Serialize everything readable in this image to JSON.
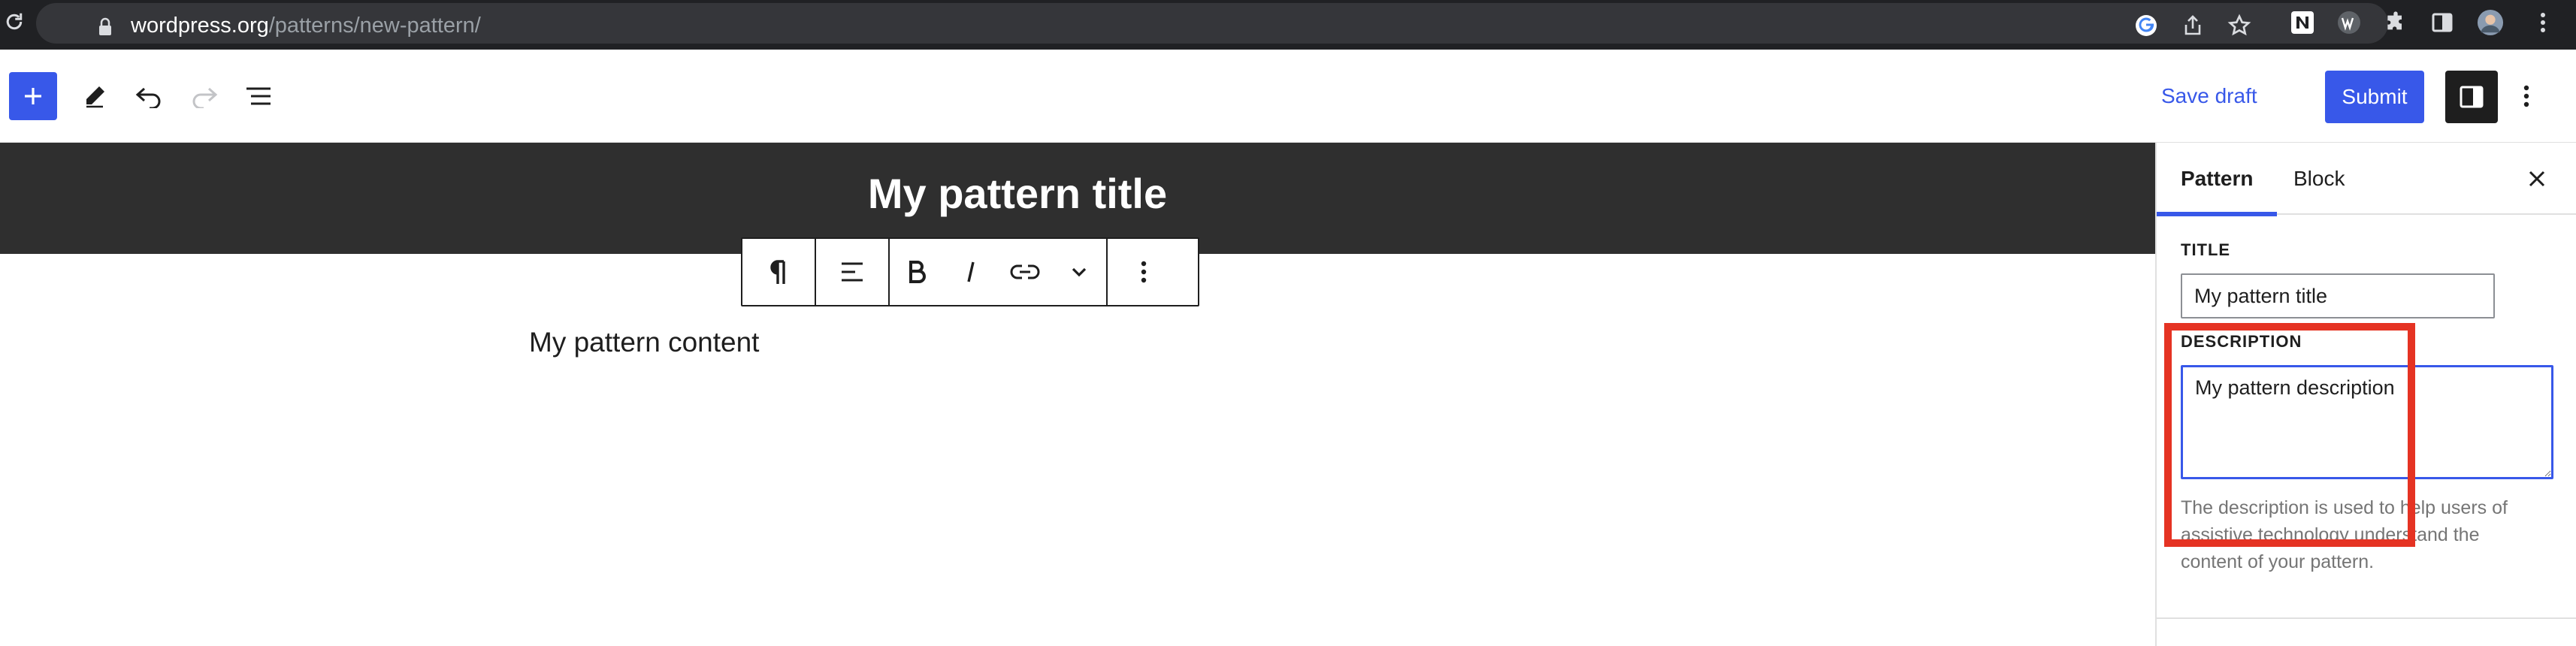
{
  "browser": {
    "url_domain": "wordpress.org",
    "url_path": "/patterns/new-pattern/",
    "icons": [
      "reload-icon",
      "lock-icon",
      "google-icon",
      "share-icon",
      "star-icon",
      "extension-n-icon",
      "extension-w-icon",
      "puzzle-icon",
      "side-panel-icon",
      "profile-avatar",
      "kebab-icon"
    ]
  },
  "header": {
    "save_draft_label": "Save draft",
    "submit_label": "Submit",
    "icons": [
      "plus-icon",
      "pencil-icon",
      "undo-icon",
      "redo-icon",
      "list-view-icon",
      "sidebar-toggle-icon",
      "options-icon"
    ]
  },
  "canvas": {
    "pattern_title": "My pattern title",
    "pattern_content": "My pattern content"
  },
  "block_toolbar": {
    "icons": [
      "paragraph-icon",
      "align-left-icon",
      "bold-icon",
      "italic-icon",
      "link-icon",
      "chevron-down-icon",
      "more-options-icon"
    ]
  },
  "sidebar": {
    "tabs": [
      {
        "label": "Pattern",
        "active": true
      },
      {
        "label": "Block",
        "active": false
      }
    ],
    "title_label": "TITLE",
    "title_value": "My pattern title",
    "description_label": "DESCRIPTION",
    "description_value": "My pattern description",
    "help_text": "The description is used to help users of assistive technology understand the content of your pattern."
  },
  "colors": {
    "accent": "#3858e9",
    "highlight": "#e53323",
    "title_band": "#2f2f2f",
    "browser_bar": "#202124"
  }
}
